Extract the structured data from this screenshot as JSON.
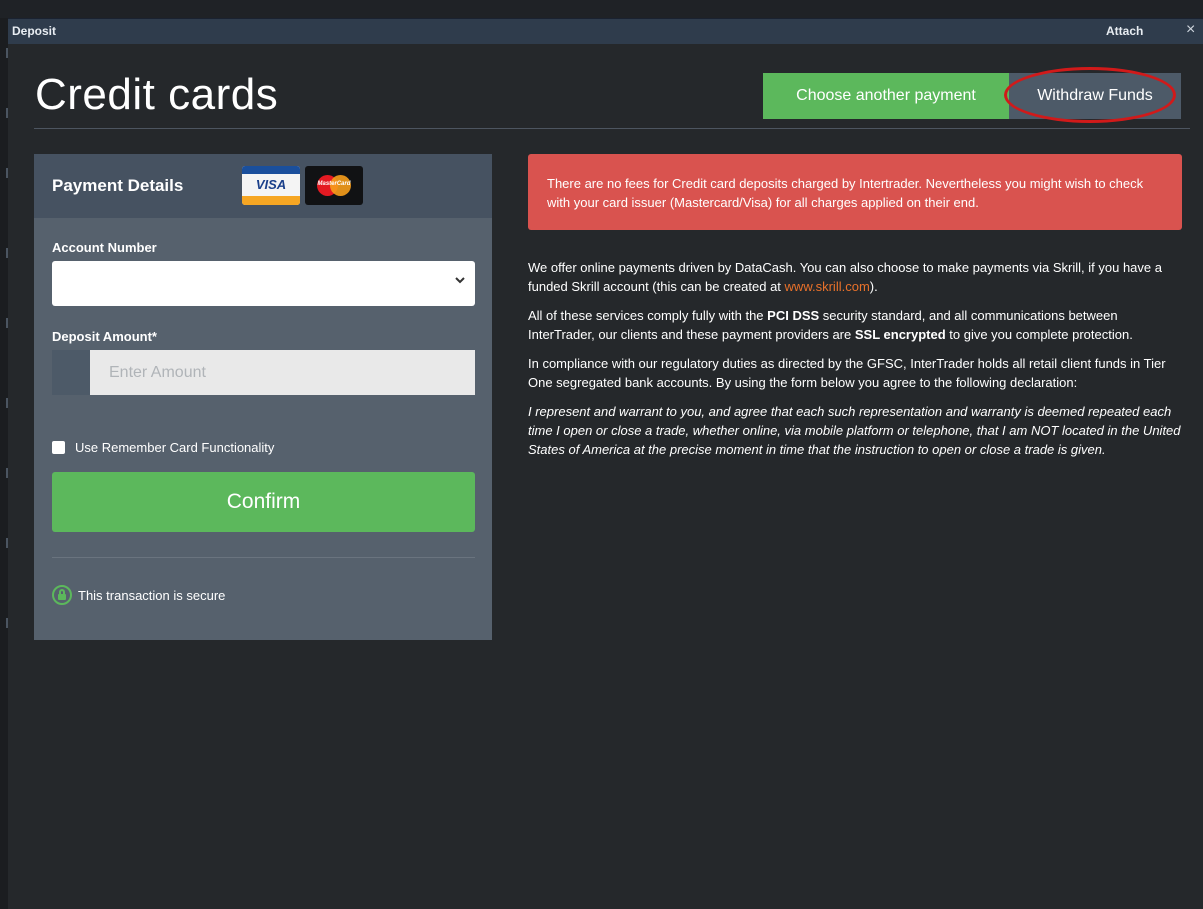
{
  "window": {
    "title": "Deposit",
    "attach_label": "Attach",
    "close_label": "×"
  },
  "page": {
    "title": "Credit cards",
    "choose_payment_label": "Choose another payment",
    "withdraw_label": "Withdraw Funds"
  },
  "payment_panel": {
    "title": "Payment Details",
    "visa_label": "VISA",
    "mastercard_label": "MasterCard",
    "account_number_label": "Account Number",
    "account_number_value": "",
    "deposit_amount_label": "Deposit Amount*",
    "amount_placeholder": "Enter Amount",
    "remember_card_label": "Use Remember Card Functionality",
    "remember_card_checked": false,
    "confirm_label": "Confirm",
    "secure_text": "This transaction is secure"
  },
  "alert": {
    "text": "There are no fees for Credit card deposits charged by Intertrader. Nevertheless you might wish to check with your card issuer (Mastercard/Visa) for all charges applied on their end."
  },
  "info": {
    "p1_a": "We offer online payments driven by DataCash. You can also choose to make payments via Skrill, if you have a funded Skrill account (this can be created at ",
    "p1_link": "www.skrill.com",
    "p1_b": ").",
    "p2_a": "All of these services comply fully with the ",
    "p2_bold1": "PCI DSS",
    "p2_b": " security standard, and all communications between InterTrader, our clients and these payment providers are ",
    "p2_bold2": "SSL encrypted",
    "p2_c": " to give you complete protection.",
    "p3": "In compliance with our regulatory duties as directed by the GFSC, InterTrader holds all retail client funds in Tier One segregated bank accounts. By using the form below you agree to the following declaration:",
    "p4": "I represent and warrant to you, and agree that each such representation and warranty is deemed repeated each time I open or close a trade, whether online, via mobile platform or telephone, that I am NOT located in the United States of America at the precise moment in time that the instruction to open or close a trade is given."
  },
  "colors": {
    "green": "#5cb85c",
    "alert_red": "#d9534f",
    "annotation_red": "#d11a1a",
    "link_orange": "#e8712b"
  }
}
